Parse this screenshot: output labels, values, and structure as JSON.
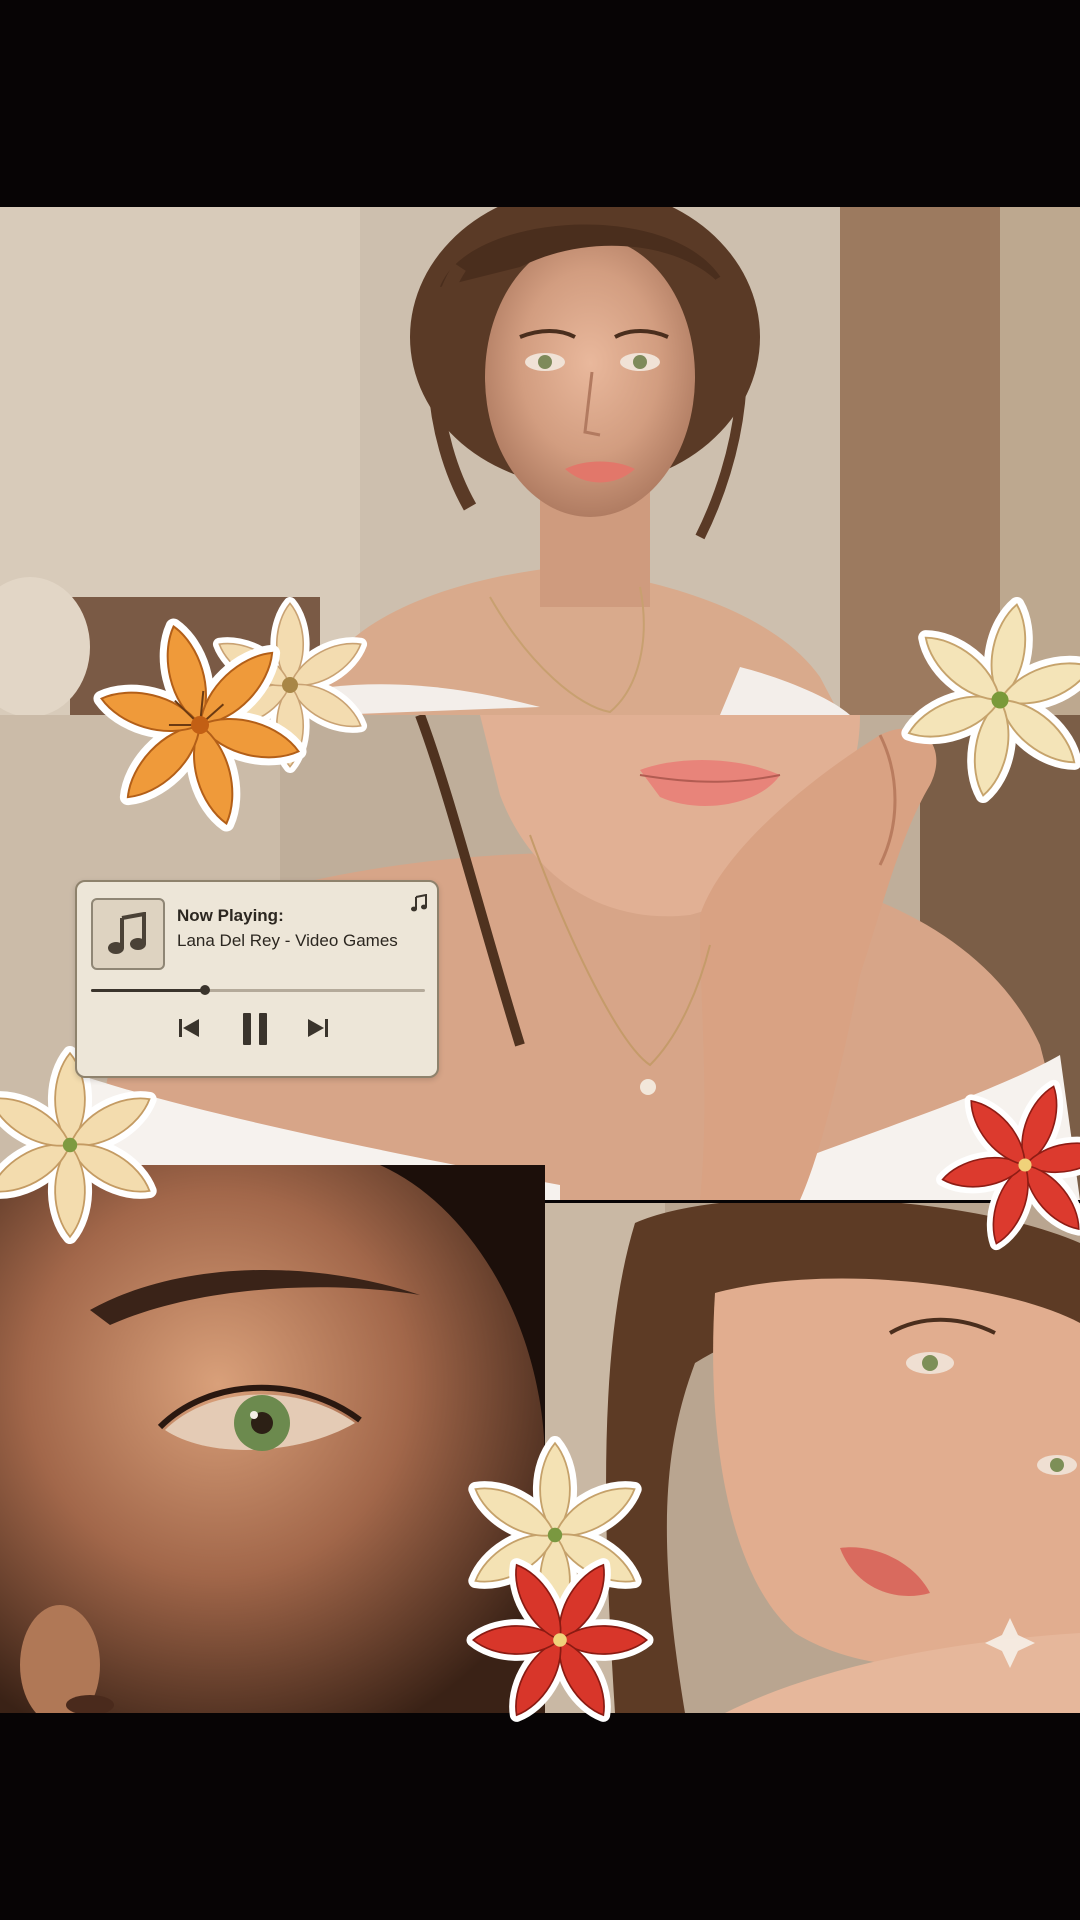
{
  "music_player": {
    "now_playing_label": "Now Playing:",
    "track_title": "Lana Del Rey - Video Games",
    "progress": 0.34,
    "icons": [
      "music-note-icon",
      "previous-track-icon",
      "pause-icon",
      "next-track-icon"
    ]
  },
  "photos": [
    "portrait-top",
    "lips-hand-closeup",
    "eye-closeup",
    "face-resting-on-arm"
  ],
  "stickers": [
    "orange-lily",
    "cream-lily",
    "red-lily"
  ],
  "colors": {
    "background": "#070405",
    "player_bg": "#ede6d8",
    "lily_orange": "#ef9a3a",
    "lily_cream": "#f3e0b2",
    "lily_red": "#dc3a2e"
  }
}
